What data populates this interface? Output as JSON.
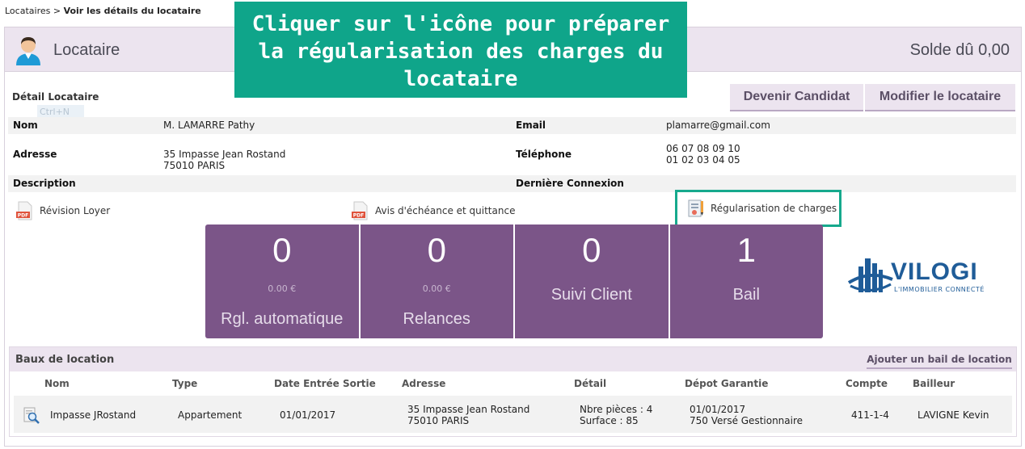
{
  "breadcrumb": {
    "parent": "Locataires",
    "separator": " > ",
    "current": "Voir les détails du locataire"
  },
  "header": {
    "title": "Locataire",
    "balance": "Solde dû 0,00",
    "icon": "user-avatar-icon"
  },
  "overlay": {
    "text": "Cliquer sur l'icône pour préparer la régularisation des charges du locataire"
  },
  "detail": {
    "section_title": "Détail Locataire",
    "ghost_shortcut": "Ctrl+N",
    "buttons": {
      "candidat": "Devenir Candidat",
      "modifier": "Modifier le locataire"
    },
    "nom_label": "Nom",
    "nom_value": "M. LAMARRE Pathy",
    "email_label": "Email",
    "email_value": "plamarre@gmail.com",
    "adresse_label": "Adresse",
    "adresse_line1": "35 Impasse Jean Rostand",
    "adresse_line2": "75010 PARIS",
    "telephone_label": "Téléphone",
    "telephone_line1": "06 07 08 09 10",
    "telephone_line2": "01 02 03 04 05",
    "description_label": "Description",
    "connexion_label": "Dernière Connexion"
  },
  "documents": {
    "revision": "Révision Loyer",
    "avis": "Avis d'échéance et quittance",
    "regularisation": "Régularisation de charges"
  },
  "stats": [
    {
      "count": "0",
      "amount": "0.00 €",
      "label": "Rgl. automatique"
    },
    {
      "count": "0",
      "amount": "0.00 €",
      "label": "Relances"
    },
    {
      "count": "0",
      "amount": "",
      "label": "Suivi Client"
    },
    {
      "count": "1",
      "amount": "",
      "label": "Bail"
    }
  ],
  "logo": {
    "brand": "VILOGI",
    "tagline": "L'IMMOBILIER CONNECTÉ"
  },
  "leases": {
    "title": "Baux de location",
    "add_button": "Ajouter un bail de location",
    "columns": [
      "Nom",
      "Type",
      "Date Entrée Sortie",
      "Adresse",
      "Détail",
      "Dépot Garantie",
      "Compte",
      "Bailleur"
    ],
    "row": {
      "nom": "Impasse JRostand",
      "type": "Appartement",
      "date": "01/01/2017",
      "adresse_line1": "35 Impasse Jean Rostand",
      "adresse_line2": "75010 PARIS",
      "detail_line1": "Nbre pièces : 4",
      "detail_line2": "Surface : 85",
      "depot_line1": "01/01/2017",
      "depot_line2": "750 Versé Gestionnaire",
      "compte": "411-1-4",
      "bailleur": "LAVIGNE Kevin"
    }
  },
  "colors": {
    "accent_purple": "#7b5588",
    "header_bg": "#ece4ef",
    "highlight_green": "#0fa58a",
    "logo_blue": "#1f5c98"
  }
}
